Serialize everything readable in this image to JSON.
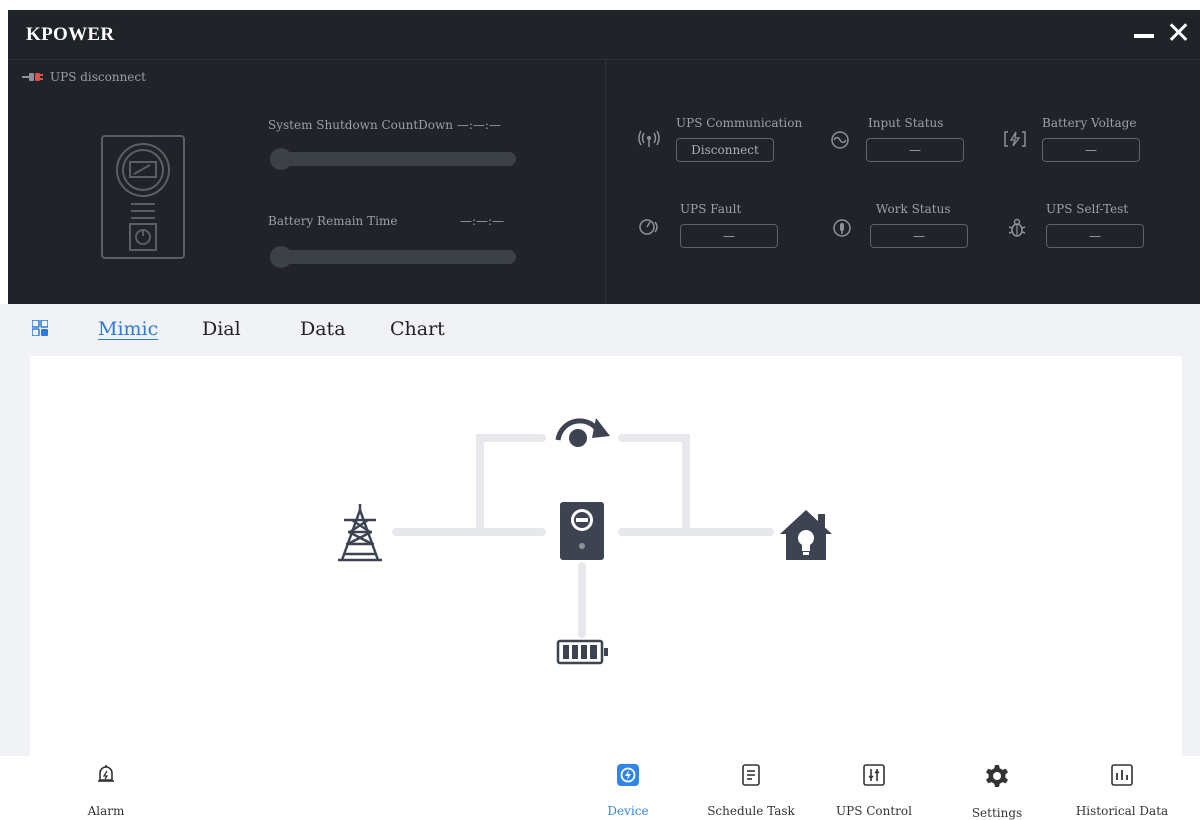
{
  "app": {
    "title": "KPOWER"
  },
  "header": {
    "connection_status": "UPS disconnect",
    "shutdown_label": "System Shutdown CountDown",
    "shutdown_value": "—:—:—",
    "battery_time_label": "Battery Remain Time",
    "battery_time_value": "—:—:—",
    "shutdown_progress": 0,
    "battery_time_progress": 0
  },
  "status_items": [
    {
      "label": "UPS Communication",
      "value": "Disconnect",
      "icon": "antenna-icon"
    },
    {
      "label": "Input Status",
      "value": "—",
      "icon": "sine-wave-icon"
    },
    {
      "label": "Battery Voltage",
      "value": "—",
      "icon": "battery-charge-icon"
    },
    {
      "label": "UPS Fault",
      "value": "—",
      "icon": "fault-gauge-icon"
    },
    {
      "label": "Work Status",
      "value": "—",
      "icon": "work-status-icon"
    },
    {
      "label": "UPS Self-Test",
      "value": "—",
      "icon": "self-test-bug-icon"
    }
  ],
  "tabs": [
    {
      "label": "Mimic",
      "active": true
    },
    {
      "label": "Dial",
      "active": false
    },
    {
      "label": "Data",
      "active": false
    },
    {
      "label": "Chart",
      "active": false
    }
  ],
  "mimic": {
    "nodes": [
      "power-tower-icon",
      "bypass-icon",
      "ups-icon",
      "house-load-icon",
      "battery-icon"
    ]
  },
  "bottom_nav": [
    {
      "label": "Alarm",
      "icon": "alarm-bell-icon",
      "active": false
    },
    {
      "label": "Device",
      "icon": "device-icon",
      "active": true
    },
    {
      "label": "Schedule Task",
      "icon": "schedule-icon",
      "active": false
    },
    {
      "label": "UPS Control",
      "icon": "control-icon",
      "active": false
    },
    {
      "label": "Settings",
      "icon": "gear-icon",
      "active": false
    },
    {
      "label": "Historical Data",
      "icon": "historical-chart-icon",
      "active": false
    }
  ],
  "colors": {
    "dark_bg": "#202327",
    "accent": "#2d7ad8",
    "mimic_icon": "#3d4350",
    "line": "#e6e8eb"
  }
}
